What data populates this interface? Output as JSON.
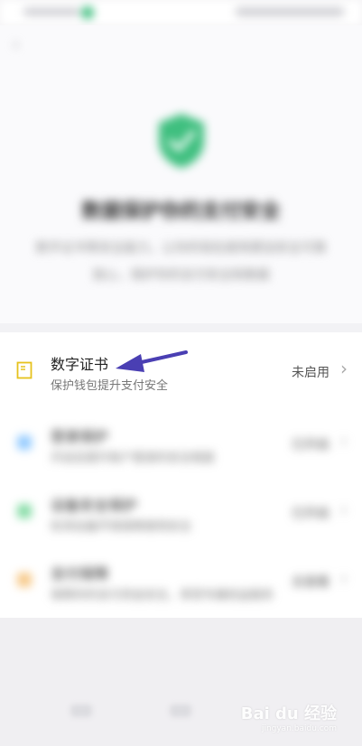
{
  "colors": {
    "background": "#f4f3f5",
    "shield": "#3fbf7f",
    "arrow": "#4a3fb3",
    "icon_yellow": "#e6c21c",
    "icon_blue": "#4aa6ff",
    "icon_green": "#35c46a",
    "icon_orange": "#f2a53a"
  },
  "header": {
    "back_icon": "chevron-left-icon",
    "back_glyph": "‹",
    "shield_icon": "shield-check-icon",
    "title": "数据保护你的支付安全",
    "description_line1": "数字证书等安全能力，让你的钱包使用更加安全可靠",
    "description_line2": "放心，保护你的支付安全和数据"
  },
  "items": [
    {
      "title": "数字证书",
      "subtitle": "保护钱包提升支付安全",
      "status": "未启用",
      "icon": "certificate-icon",
      "chevron": "›"
    },
    {
      "title": "登录保护",
      "subtitle": "开启后提升账户登录的安全程度",
      "status": "已开启",
      "icon": "shield-icon",
      "chevron": "›"
    },
    {
      "title": "设备安全保护",
      "subtitle": "检测设备环境保障使用安全",
      "status": "已开启",
      "icon": "device-icon",
      "chevron": "›"
    },
    {
      "title": "支付保障",
      "subtitle": "保障你的支付资金安全，享受专属权益服务",
      "status": "去查看",
      "icon": "lock-icon",
      "chevron": "›"
    }
  ],
  "watermark": {
    "text": "Bai du 经验",
    "sub": "jingyan.baidu.com"
  }
}
